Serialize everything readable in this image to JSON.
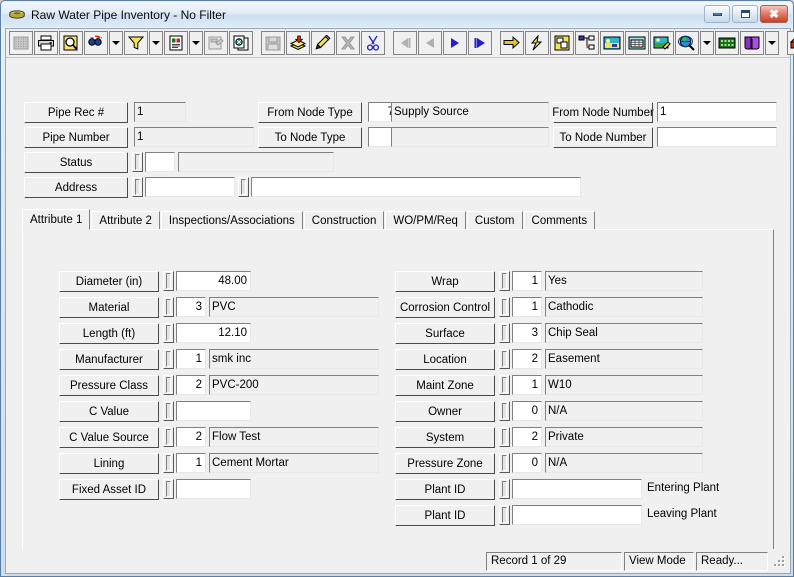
{
  "window": {
    "title": "Raw Water Pipe Inventory - No Filter",
    "icon": "pipe-icon",
    "buttons": {
      "minimize": "minimize-button",
      "maximize": "maximize-button",
      "close": "close-button"
    }
  },
  "toolbar": {
    "groups": [
      {
        "items": [
          {
            "name": "grid-view-icon",
            "kind": "button",
            "disabled": true
          },
          {
            "name": "print-icon",
            "kind": "button",
            "disabled": false
          },
          {
            "name": "print-preview-icon",
            "kind": "button",
            "disabled": false
          },
          {
            "name": "find-icon",
            "kind": "button",
            "disabled": false
          },
          {
            "name": "find-dropdown",
            "kind": "dropdown",
            "disabled": false
          },
          {
            "name": "filter-icon",
            "kind": "button",
            "disabled": false
          },
          {
            "name": "filter-dropdown",
            "kind": "dropdown",
            "disabled": false
          },
          {
            "name": "report-icon",
            "kind": "button",
            "disabled": false
          },
          {
            "name": "report-dropdown",
            "kind": "dropdown",
            "disabled": false
          },
          {
            "name": "form-design-icon",
            "kind": "button",
            "disabled": true
          },
          {
            "name": "copy-record-icon",
            "kind": "button",
            "disabled": false
          }
        ]
      },
      {
        "items": [
          {
            "name": "save-icon",
            "kind": "button",
            "disabled": true
          },
          {
            "name": "add-record-icon",
            "kind": "button",
            "disabled": false
          },
          {
            "name": "edit-icon",
            "kind": "button",
            "disabled": false
          },
          {
            "name": "delete-icon",
            "kind": "button",
            "disabled": true
          },
          {
            "name": "cut-icon",
            "kind": "button",
            "disabled": false
          }
        ]
      },
      {
        "items": [
          {
            "name": "first-record-icon",
            "kind": "button",
            "disabled": true
          },
          {
            "name": "previous-record-icon",
            "kind": "button",
            "disabled": true
          },
          {
            "name": "next-record-icon",
            "kind": "button",
            "disabled": false
          },
          {
            "name": "last-record-icon",
            "kind": "button",
            "disabled": false
          }
        ]
      },
      {
        "items": [
          {
            "name": "goto-icon",
            "kind": "button",
            "disabled": false
          },
          {
            "name": "quick-action-icon",
            "kind": "button",
            "disabled": false
          },
          {
            "name": "layout-icon",
            "kind": "button",
            "disabled": false
          },
          {
            "name": "hierarchy-icon",
            "kind": "button",
            "disabled": false
          },
          {
            "name": "map-view-icon",
            "kind": "button",
            "disabled": false
          },
          {
            "name": "calendar-icon",
            "kind": "button",
            "disabled": false
          },
          {
            "name": "image-edit-icon",
            "kind": "button",
            "disabled": false
          },
          {
            "name": "web-search-icon",
            "kind": "button",
            "disabled": false
          },
          {
            "name": "web-dropdown",
            "kind": "dropdown",
            "disabled": false
          },
          {
            "name": "keypad-icon",
            "kind": "button",
            "disabled": false
          },
          {
            "name": "help-book-icon",
            "kind": "button",
            "disabled": false
          },
          {
            "name": "help-dropdown",
            "kind": "dropdown",
            "disabled": false
          }
        ]
      },
      {
        "items": [
          {
            "name": "exit-icon",
            "kind": "button",
            "disabled": false
          }
        ]
      }
    ]
  },
  "header": {
    "pipe_rec_label": "Pipe Rec #",
    "pipe_rec_value": "1",
    "pipe_number_label": "Pipe Number",
    "pipe_number_value": "1",
    "status_label": "Status",
    "status_code": "",
    "status_desc": "",
    "address_label": "Address",
    "address_number": "",
    "address_street": "",
    "from_node_type_label": "From Node Type",
    "from_node_type_code": "7",
    "from_node_type_desc": "Supply Source",
    "to_node_type_label": "To Node Type",
    "to_node_type_code": "",
    "to_node_type_desc": "",
    "from_node_number_label": "From Node Number",
    "from_node_number_value": "1",
    "to_node_number_label": "To Node Number",
    "to_node_number_value": ""
  },
  "tabs": [
    {
      "label": "Attribute 1",
      "active": true
    },
    {
      "label": "Attribute 2",
      "active": false
    },
    {
      "label": "Inspections/Associations",
      "active": false
    },
    {
      "label": "Construction",
      "active": false
    },
    {
      "label": "WO/PM/Req",
      "active": false
    },
    {
      "label": "Custom",
      "active": false
    },
    {
      "label": "Comments",
      "active": false
    }
  ],
  "attribute1": {
    "left_fields": [
      {
        "label": "Diameter (in)",
        "spinner": true,
        "code": "",
        "value": "48.00",
        "numeric": true,
        "has_desc": false
      },
      {
        "label": "Material",
        "spinner": true,
        "code": "3",
        "value": "PVC",
        "numeric": false,
        "has_desc": true
      },
      {
        "label": "Length (ft)",
        "spinner": true,
        "code": "",
        "value": "12.10",
        "numeric": true,
        "has_desc": false
      },
      {
        "label": "Manufacturer",
        "spinner": true,
        "code": "1",
        "value": "smk inc",
        "numeric": false,
        "has_desc": true
      },
      {
        "label": "Pressure Class",
        "spinner": true,
        "code": "2",
        "value": "PVC-200",
        "numeric": false,
        "has_desc": true
      },
      {
        "label": "C Value",
        "spinner": true,
        "code": "",
        "value": "",
        "numeric": true,
        "has_desc": false
      },
      {
        "label": "C Value Source",
        "spinner": true,
        "code": "2",
        "value": "Flow Test",
        "numeric": false,
        "has_desc": true
      },
      {
        "label": "Lining",
        "spinner": true,
        "code": "1",
        "value": "Cement Mortar",
        "numeric": false,
        "has_desc": true
      },
      {
        "label": "Fixed Asset ID",
        "spinner": true,
        "code": "",
        "value": "",
        "numeric": false,
        "has_desc": false
      }
    ],
    "right_fields": [
      {
        "label": "Wrap",
        "spinner": true,
        "code": "1",
        "value": "Yes",
        "has_desc": true,
        "suffix": ""
      },
      {
        "label": "Corrosion Control",
        "spinner": true,
        "code": "1",
        "value": "Cathodic",
        "has_desc": true,
        "suffix": ""
      },
      {
        "label": "Surface",
        "spinner": true,
        "code": "3",
        "value": "Chip Seal",
        "has_desc": true,
        "suffix": ""
      },
      {
        "label": "Location",
        "spinner": true,
        "code": "2",
        "value": "Easement",
        "has_desc": true,
        "suffix": ""
      },
      {
        "label": "Maint Zone",
        "spinner": true,
        "code": "1",
        "value": "W10",
        "has_desc": true,
        "suffix": ""
      },
      {
        "label": "Owner",
        "spinner": true,
        "code": "0",
        "value": "N/A",
        "has_desc": true,
        "suffix": ""
      },
      {
        "label": "System",
        "spinner": true,
        "code": "2",
        "value": "Private",
        "has_desc": true,
        "suffix": ""
      },
      {
        "label": "Pressure Zone",
        "spinner": true,
        "code": "0",
        "value": "N/A",
        "has_desc": true,
        "suffix": ""
      },
      {
        "label": "Plant ID",
        "spinner": true,
        "code": "",
        "value": "",
        "has_desc": false,
        "suffix": "Entering Plant"
      },
      {
        "label": "Plant ID",
        "spinner": true,
        "code": "",
        "value": "",
        "has_desc": false,
        "suffix": "Leaving Plant"
      }
    ]
  },
  "statusbar": {
    "record": "Record 1 of 29",
    "mode": "View Mode",
    "state": "Ready..."
  }
}
